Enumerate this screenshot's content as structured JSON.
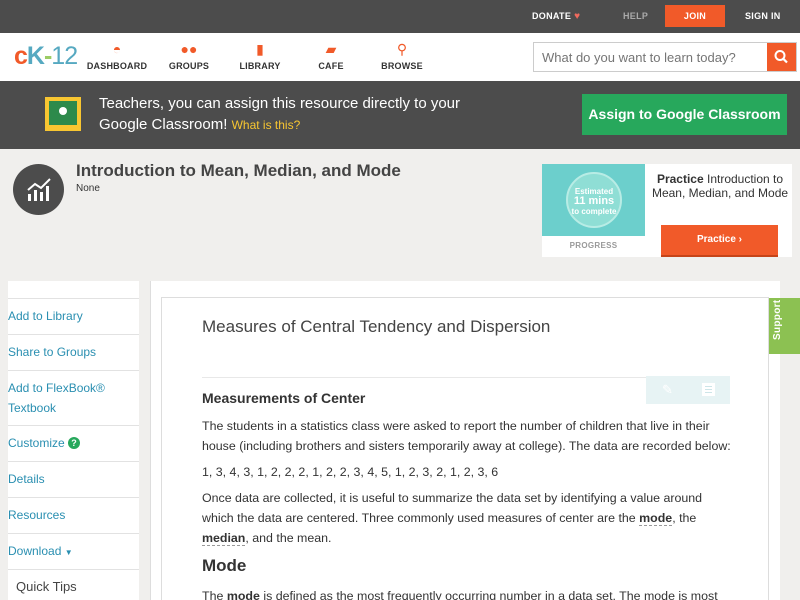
{
  "topbar": {
    "donate": "DONATE",
    "help": "HELP",
    "join": "JOIN",
    "signin": "SIGN IN"
  },
  "header": {
    "logo": {
      "c": "c",
      "k": "K",
      "dash": "-",
      "n": "12"
    },
    "nav": [
      {
        "label": "DASHBOARD",
        "icon": "dashboard-icon"
      },
      {
        "label": "GROUPS",
        "icon": "groups-icon"
      },
      {
        "label": "LIBRARY",
        "icon": "library-icon"
      },
      {
        "label": "CAFE",
        "icon": "cafe-icon"
      },
      {
        "label": "BROWSE",
        "icon": "browse-icon"
      }
    ],
    "search_placeholder": "What do you want to learn today?"
  },
  "google_banner": {
    "text": "Teachers, you can assign this resource directly to your Google Classroom!",
    "link": "What is this?",
    "button": "Assign to Google Classroom"
  },
  "resource": {
    "title": "Introduction to Mean, Median, and Mode",
    "subtitle": "None"
  },
  "practice_card": {
    "estimate_line1": "Estimated",
    "estimate_line2": "11 mins",
    "estimate_line3": "to complete",
    "progress_label": "PROGRESS",
    "title_bold": "Practice",
    "title_rest": "Introduction to Mean, Median, and Mode",
    "button": "Practice"
  },
  "sidebar": {
    "items": [
      "Add to Library",
      "Share to Groups",
      "Add to FlexBook® Textbook",
      "Customize",
      "Details",
      "Resources",
      "Download"
    ],
    "quick_tips": "Quick Tips"
  },
  "content": {
    "title": "Measures of Central Tendency and Dispersion",
    "h_center": "Measurements of Center",
    "p1": "The students in a statistics class were asked to report the number of children that live in their house (including brothers and sisters temporarily away at college). The data are recorded below:",
    "data": "1, 3, 4, 3, 1, 2, 2, 2, 1, 2, 2, 3, 4, 5, 1, 2, 3, 2, 1, 2, 3, 6",
    "p2_a": "Once data are collected, it is useful to summarize the data set by identifying a value around which the data are centered. Three commonly used measures of center are the",
    "p2_mode": "mode",
    "p2_comma": ", the",
    "p2_median": "median",
    "p2_end": ", and the mean.",
    "h_mode": "Mode",
    "p3_a": "The",
    "p3_mode": "mode",
    "p3_b": "is defined as the most frequently occurring number in a data set. The mode is most"
  },
  "support": "Support",
  "colors": {
    "accent": "#f15a29",
    "dark_bar": "#4c4c4c",
    "green": "#27a85c",
    "link": "#2a8fb1"
  }
}
